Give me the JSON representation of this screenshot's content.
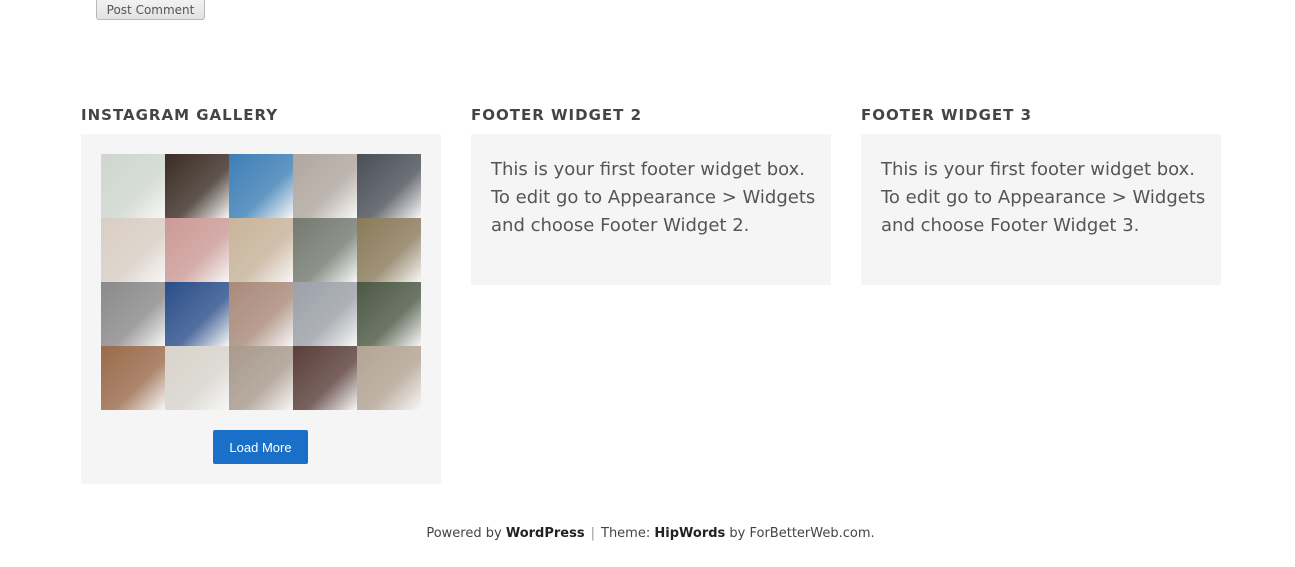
{
  "comment_form": {
    "submit_label": "Post Comment"
  },
  "widgets": [
    {
      "title": "INSTAGRAM GALLERY",
      "load_more_label": "Load More",
      "tiles": [
        {
          "color": "#cfd6cf",
          "icon": "panda-photo"
        },
        {
          "color": "#3a2c24",
          "icon": "coffee-photo"
        },
        {
          "color": "#3c7fb6",
          "icon": "coast-photo"
        },
        {
          "color": "#b0a79f",
          "icon": "portrait-photo"
        },
        {
          "color": "#4a4f58",
          "icon": "fashion-photo"
        },
        {
          "color": "#d9cec4",
          "icon": "sleeping-photo"
        },
        {
          "color": "#cc9a96",
          "icon": "smoothie-photo"
        },
        {
          "color": "#c8b49a",
          "icon": "breakfast-photo"
        },
        {
          "color": "#747a70",
          "icon": "outfit-photo"
        },
        {
          "color": "#8a7a5a",
          "icon": "desert-photo"
        },
        {
          "color": "#8a8a8a",
          "icon": "bedroom-photo"
        },
        {
          "color": "#2a4e8a",
          "icon": "blue-wall-photo"
        },
        {
          "color": "#a98a7a",
          "icon": "girl-photo"
        },
        {
          "color": "#9ca0a8",
          "icon": "heart-photo"
        },
        {
          "color": "#4c5844",
          "icon": "flowers-photo"
        },
        {
          "color": "#9a6a4a",
          "icon": "face-photo"
        },
        {
          "color": "#d8d4cc",
          "icon": "strawberry-photo"
        },
        {
          "color": "#a89a8c",
          "icon": "tea-photo"
        },
        {
          "color": "#5a3e3a",
          "icon": "drink-photo"
        },
        {
          "color": "#b3a494",
          "icon": "baby-photo"
        }
      ]
    },
    {
      "title": "FOOTER WIDGET 2",
      "text": "This is your first footer widget box. To edit go to Appearance > Widgets and choose Footer Widget 2."
    },
    {
      "title": "FOOTER WIDGET 3",
      "text": "This is your first footer widget box. To edit go to Appearance > Widgets and choose Footer Widget 3."
    }
  ],
  "footer": {
    "powered_by": "Powered by",
    "wordpress": "WordPress",
    "separator": "|",
    "theme_label": "Theme:",
    "theme_name": "HipWords",
    "by_text": "by ForBetterWeb.com."
  }
}
